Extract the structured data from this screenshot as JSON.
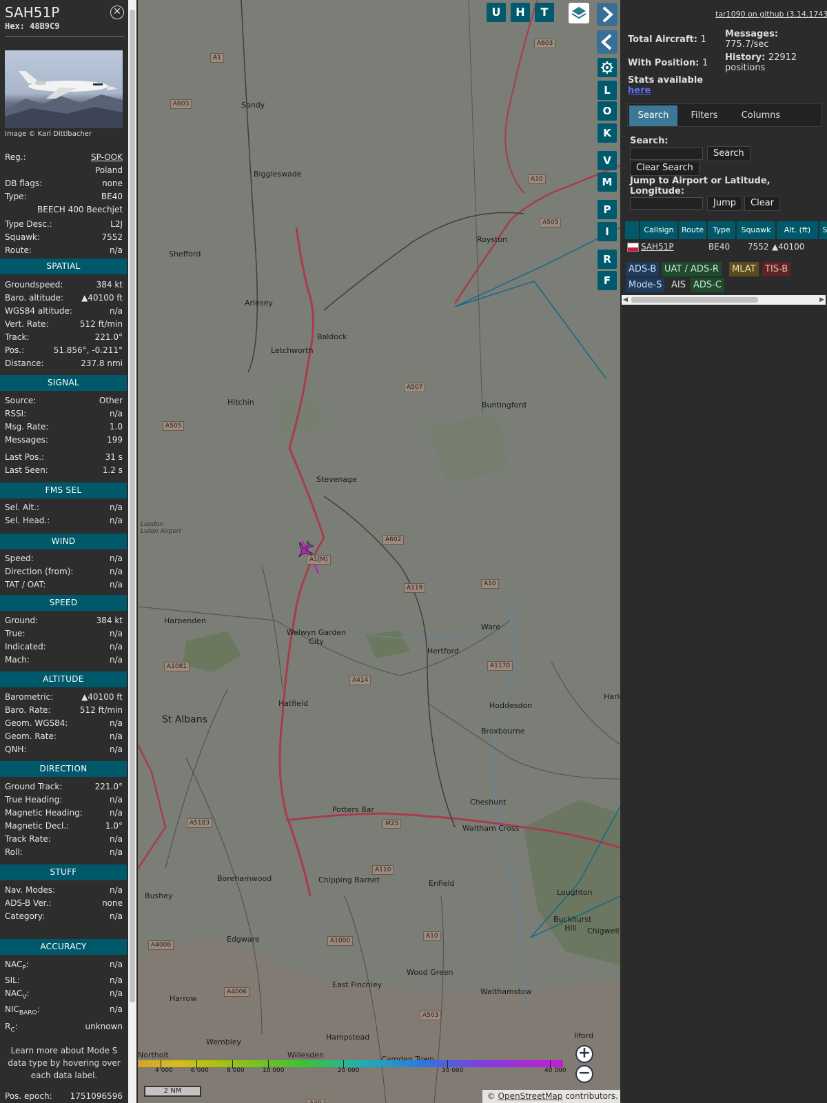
{
  "aircraft": {
    "callsign": "SAH51P",
    "hex": "Hex: 48B9C9",
    "photo_credit": "Image © Karl Dittlbacher",
    "details": [
      {
        "label": "Reg.:",
        "value": "SP-OOK"
      },
      {
        "label": "",
        "value": "Poland"
      },
      {
        "label": "DB flags:",
        "value": "none"
      },
      {
        "label": "Type:",
        "value": "BE40"
      },
      {
        "label": "",
        "value": "BEECH 400 Beechjet"
      },
      {
        "label": "Type Desc.:",
        "value": "L2J"
      },
      {
        "label": "Squawk:",
        "value": "7552"
      },
      {
        "label": "Route:",
        "value": "n/a"
      }
    ]
  },
  "sections": {
    "spatial": {
      "title": "SPATIAL",
      "rows": [
        {
          "label": "Groundspeed:",
          "value": "384 kt"
        },
        {
          "label": "Baro. altitude:",
          "value": "▲40100 ft"
        },
        {
          "label": "WGS84 altitude:",
          "value": "n/a"
        },
        {
          "label": "Vert. Rate:",
          "value": "512 ft/min"
        },
        {
          "label": "Track:",
          "value": "221.0°"
        },
        {
          "label": "Pos.:",
          "value": "51.856°, -0.211°"
        },
        {
          "label": "Distance:",
          "value": "237.8 nmi"
        }
      ]
    },
    "signal": {
      "title": "SIGNAL",
      "rows": [
        {
          "label": "Source:",
          "value": "Other"
        },
        {
          "label": "RSSI:",
          "value": "n/a"
        },
        {
          "label": "Msg. Rate:",
          "value": "1.0"
        },
        {
          "label": "Messages:",
          "value": "199"
        },
        {
          "label": "Last Pos.:",
          "value": "31 s"
        },
        {
          "label": "Last Seen:",
          "value": "1.2 s"
        }
      ]
    },
    "fms": {
      "title": "FMS SEL",
      "rows": [
        {
          "label": "Sel. Alt.:",
          "value": "n/a"
        },
        {
          "label": "Sel. Head.:",
          "value": "n/a"
        }
      ]
    },
    "wind": {
      "title": "WIND",
      "rows": [
        {
          "label": "Speed:",
          "value": "n/a"
        },
        {
          "label": "Direction (from):",
          "value": "n/a"
        },
        {
          "label": "TAT / OAT:",
          "value": "n/a"
        }
      ]
    },
    "speed": {
      "title": "SPEED",
      "rows": [
        {
          "label": "Ground:",
          "value": "384 kt"
        },
        {
          "label": "True:",
          "value": "n/a"
        },
        {
          "label": "Indicated:",
          "value": "n/a"
        },
        {
          "label": "Mach:",
          "value": "n/a"
        }
      ]
    },
    "altitude": {
      "title": "ALTITUDE",
      "rows": [
        {
          "label": "Barometric:",
          "value": "▲40100 ft"
        },
        {
          "label": "Baro. Rate:",
          "value": "512 ft/min"
        },
        {
          "label": "Geom. WGS84:",
          "value": "n/a"
        },
        {
          "label": "Geom. Rate:",
          "value": "n/a"
        },
        {
          "label": "QNH:",
          "value": "n/a"
        }
      ]
    },
    "direction": {
      "title": "DIRECTION",
      "rows": [
        {
          "label": "Ground Track:",
          "value": "221.0°"
        },
        {
          "label": "True Heading:",
          "value": "n/a"
        },
        {
          "label": "Magnetic Heading:",
          "value": "n/a"
        },
        {
          "label": "Magnetic Decl.:",
          "value": "1.0°"
        },
        {
          "label": "Track Rate:",
          "value": "n/a"
        },
        {
          "label": "Roll:",
          "value": "n/a"
        }
      ]
    },
    "stuff": {
      "title": "STUFF",
      "rows": [
        {
          "label": "Nav. Modes:",
          "value": "n/a"
        },
        {
          "label": "ADS-B Ver.:",
          "value": "none"
        },
        {
          "label": "Category:",
          "value": "n/a"
        }
      ]
    },
    "accuracy": {
      "title": "ACCURACY",
      "rows": [
        {
          "label": "NAC",
          "sub": "P",
          "value": "n/a"
        },
        {
          "label": "SIL:",
          "sub": "",
          "value": "n/a"
        },
        {
          "label": "NAC",
          "sub": "V",
          "value": "n/a"
        },
        {
          "label": "NIC",
          "sub": "BARO",
          "value": "n/a"
        },
        {
          "label": "R",
          "sub": "C",
          "value": "unknown"
        }
      ]
    }
  },
  "learn_more": "Learn more about Mode S data type by hovering over each data label.",
  "pos_epoch": {
    "label": "Pos. epoch:",
    "value": "1751096596"
  },
  "map": {
    "top_buttons": [
      "U",
      "H",
      "T"
    ],
    "side_buttons": [
      "L",
      "O",
      "K",
      "V",
      "M",
      "P",
      "I",
      "R",
      "F"
    ],
    "towns": [
      "Sandy",
      "Biggleswade",
      "Shefford",
      "Arlesey",
      "Letchworth",
      "Baldock",
      "Royston",
      "Hitchin",
      "Buntingford",
      "Stevenage",
      "London Luton Airport",
      "Harpenden",
      "Welwyn Garden City",
      "Ware",
      "Hertford",
      "Hoddesdon",
      "Broxbourne",
      "Hatfield",
      "St Albans",
      "Potters Bar",
      "Cheshunt",
      "Waltham Cross",
      "Borehamwood",
      "Chipping Barnet",
      "Enfield",
      "Bushey",
      "Edgware",
      "Loughton",
      "Buckhurst Hill",
      "Chigwell",
      "Harrow",
      "East Finchley",
      "Wood Green",
      "Walthamstow",
      "Hampstead",
      "Wembley",
      "Willesden",
      "Northolt",
      "Camden Town",
      "Ilford",
      "Harlo"
    ],
    "roads": [
      "A1",
      "A603",
      "A603",
      "A10",
      "A505",
      "A507",
      "A505",
      "A602",
      "A1(M)",
      "A119",
      "A10",
      "A1081",
      "A414",
      "A1170",
      "A5183",
      "M25",
      "A110",
      "A4008",
      "A1000",
      "A10",
      "A4006",
      "A503",
      "A40"
    ],
    "altitude_ticks": [
      "4 000",
      "6 000",
      "8 000",
      "10 000",
      "20 000",
      "30 000",
      "40 000"
    ],
    "scale": "2 NM",
    "attribution_prefix": "© ",
    "attribution_link": "OpenStreetMap",
    "attribution_suffix": " contributors."
  },
  "panel": {
    "github": "tar1090 on github (3.14.1743)",
    "total_aircraft_label": "Total Aircraft:",
    "total_aircraft": "1",
    "with_position_label": "With Position:",
    "with_position": "1",
    "messages_label": "Messages:",
    "messages_value": "775.7/sec",
    "history_label": "History:",
    "history_value": "22912",
    "history_unit": "positions",
    "stats_text": "Stats available",
    "stats_link": "here",
    "tabs": [
      "Search",
      "Filters",
      "Columns"
    ],
    "search_label": "Search:",
    "search_button": "Search",
    "clear_search_button": "Clear Search",
    "jump_label": "Jump to Airport or Latitude, Longitude:",
    "jump_button": "Jump",
    "clear_button": "Clear",
    "columns": [
      "Callsign",
      "Route",
      "Type",
      "Squawk",
      "Alt. (ft)",
      "Spd"
    ],
    "table_row": {
      "callsign": "SAH51P",
      "type": "BE40",
      "squawk": "7552",
      "alt": "▲40100"
    },
    "badges": [
      "ADS-B",
      "UAT / ADS-R",
      "MLAT",
      "TIS-B",
      "Mode-S",
      "AIS",
      "ADS-C"
    ],
    "badge_colors": [
      "#1e3a5c",
      "#1e4a2e",
      "#5a4a22",
      "#5c2424",
      "#1e3a5c",
      "#2b2b2b",
      "#1e4a2e"
    ]
  }
}
